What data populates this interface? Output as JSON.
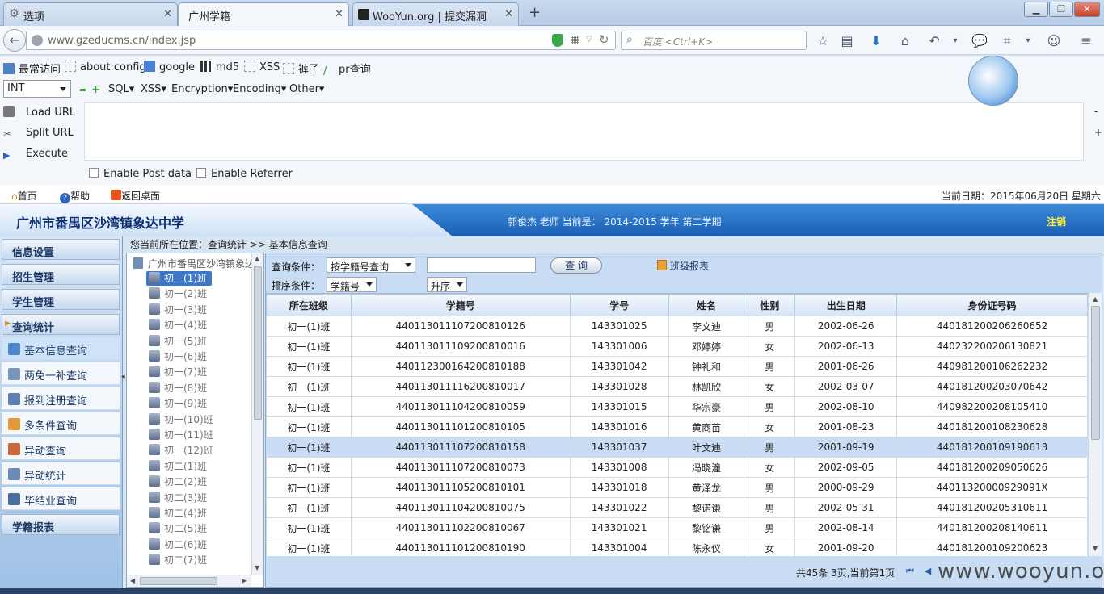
{
  "browser": {
    "tabs": [
      {
        "label": "选项"
      },
      {
        "label": "广州学籍"
      },
      {
        "label": "WooYun.org | 提交漏洞"
      }
    ],
    "new_tab": "+",
    "url": "www.gzeducms.cn/index.jsp",
    "search_placeholder": "百度 <Ctrl+K>"
  },
  "bookmarks": [
    {
      "label": "最常访问"
    },
    {
      "label": "about:config"
    },
    {
      "label": "google"
    },
    {
      "label": "md5"
    },
    {
      "label": "XSS"
    },
    {
      "label": "裤子"
    },
    {
      "label": "pr查询"
    }
  ],
  "hackbar": {
    "type_select": "INT",
    "menus": [
      "SQL",
      "XSS",
      "Encryption",
      "Encoding",
      "Other"
    ],
    "load_url": "Load URL",
    "split_url": "Split URL",
    "execute": "Execute",
    "enable_post": "Enable Post data",
    "enable_referrer": "Enable Referrer"
  },
  "top_links": {
    "home": "首页",
    "help": "帮助",
    "back_desktop": "返回桌面",
    "date": "当前日期：2015年06月20日 星期六"
  },
  "banner": {
    "school": "广州市番禺区沙湾镇象达中学",
    "info": "郭俊杰 老师   当前是： 2014-2015 学年   第二学期",
    "logout": "注销"
  },
  "menu": {
    "sections": [
      "信息设置",
      "招生管理",
      "学生管理",
      "查询统计",
      "学籍报表"
    ],
    "items": [
      "基本信息查询",
      "两免一补查询",
      "报到注册查询",
      "多条件查询",
      "异动查询",
      "异动统计",
      "毕结业查询"
    ]
  },
  "breadcrumb": "您当前所在位置：查询统计 >> 基本信息查询",
  "tree": {
    "root": "广州市番禺区沙湾镇象达",
    "classes": [
      "初一(1)班",
      "初一(2)班",
      "初一(3)班",
      "初一(4)班",
      "初一(5)班",
      "初一(6)班",
      "初一(7)班",
      "初一(8)班",
      "初一(9)班",
      "初一(10)班",
      "初一(11)班",
      "初一(12)班",
      "初二(1)班",
      "初二(2)班",
      "初二(3)班",
      "初二(4)班",
      "初二(5)班",
      "初二(6)班",
      "初二(7)班"
    ]
  },
  "query": {
    "cond_label": "查询条件：",
    "cond_value": "按学籍号查询",
    "sort_label": "排序条件：",
    "sort_value": "学籍号",
    "order_value": "升序",
    "search_button": "查 询",
    "report_link": "班级报表"
  },
  "table": {
    "headers": [
      "所在班级",
      "学籍号",
      "学号",
      "姓名",
      "性别",
      "出生日期",
      "身份证号码"
    ],
    "rows": [
      [
        "初一(1)班",
        "4401130111072008​10126",
        "143301025",
        "李文迪",
        "男",
        "2002-06-26",
        "440181200206260652"
      ],
      [
        "初一(1)班",
        "440113011109200810016",
        "143301006",
        "邓婷婷",
        "女",
        "2002-06-13",
        "440232200206130821"
      ],
      [
        "初一(1)班",
        "440112300164200810188",
        "143301042",
        "钟礼和",
        "男",
        "2001-06-26",
        "440981200106262232"
      ],
      [
        "初一(1)班",
        "440113011116200810017",
        "143301028",
        "林凯欣",
        "女",
        "2002-03-07",
        "440181200203070642"
      ],
      [
        "初一(1)班",
        "440113011104200810059",
        "143301015",
        "华宗豪",
        "男",
        "2002-08-10",
        "440982200208105410"
      ],
      [
        "初一(1)班",
        "440113011101200810105",
        "143301016",
        "黄商苗",
        "女",
        "2001-08-23",
        "440181200108230628"
      ],
      [
        "初一(1)班",
        "440113011107200810158",
        "143301037",
        "叶文迪",
        "男",
        "2001-09-19",
        "440181200109190613"
      ],
      [
        "初一(1)班",
        "440113011107200810073",
        "143301008",
        "冯晓潼",
        "女",
        "2002-09-05",
        "440181200209050626"
      ],
      [
        "初一(1)班",
        "440113011105200810101",
        "143301018",
        "黄泽龙",
        "男",
        "2000-09-29",
        "44011320000929091X"
      ],
      [
        "初一(1)班",
        "440113011104200810075",
        "143301022",
        "黎诺谦",
        "男",
        "2002-05-31",
        "440181200205310611"
      ],
      [
        "初一(1)班",
        "440113011102200810067",
        "143301021",
        "黎铭谦",
        "男",
        "2002-08-14",
        "440181200208140611"
      ],
      [
        "初一(1)班",
        "440113011101200810190",
        "143301004",
        "陈永仪",
        "女",
        "2001-09-20",
        "440181200109200623"
      ]
    ],
    "highlight_row": 6
  },
  "pager": {
    "info": "共45条   3页,当前第1页"
  },
  "watermark": "www.wooyun.org"
}
